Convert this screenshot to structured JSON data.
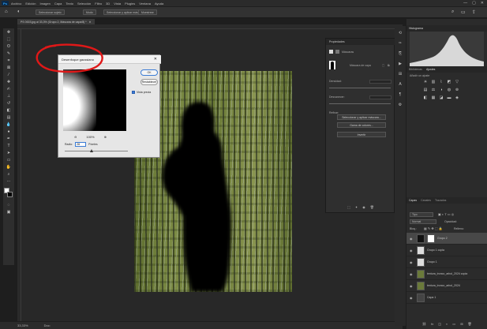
{
  "app": {
    "logo": "Ps",
    "menu": [
      "Archivo",
      "Edición",
      "Imagen",
      "Capa",
      "Texto",
      "Selección",
      "Filtro",
      "3D",
      "Vista",
      "Plugins",
      "Ventana",
      "Ayuda"
    ],
    "window_controls": [
      "—",
      "▢",
      "✕"
    ]
  },
  "options_bar": {
    "select_subject": "Seleccionar sujeto",
    "mode_icon_label": "Modo",
    "select_mask": "Seleccionar y aplicar máscara...",
    "option_extra": "Muestrear"
  },
  "document_tab": {
    "title": "PS 0003.jpg al 33,3% (Grupo 2, Máscara de capa/8) *",
    "close": "✕"
  },
  "status_bar": {
    "zoom": "33,33%",
    "info": "Doc:"
  },
  "dialog": {
    "title": "Desenfoque gaussiano",
    "close": "✕",
    "ok": "OK",
    "reset": "Restablecer",
    "preview_label": "Vista previa",
    "zoom_out": "⊖",
    "zoom_level": "100%",
    "zoom_in": "⊕",
    "radius_label": "Radio:",
    "radius_value": "28",
    "radius_unit": "Píxeles"
  },
  "properties": {
    "header": "Propiedades",
    "mask_label": "Máscaras",
    "layer_mask": "Máscara de capa",
    "density_label": "Densidad:",
    "feather_label": "Desvanecer:",
    "refine_label": "Refinar:",
    "select_and_mask": "Seleccionar y aplicar máscara...",
    "color_range": "Gama de colores...",
    "invert": "Invertir"
  },
  "right_panels": {
    "histogram_tab": "Histograma",
    "library_tab": "Bibliotecas",
    "adjustments_tab": "Ajustes",
    "add_adjustment": "Añadir un ajuste",
    "layers_tab": "Capas",
    "channels_tab": "Canales",
    "paths_tab": "Trazados",
    "kind_filter": "Tipo",
    "blend_mode": "Normal",
    "opacity_label": "Opacidad:",
    "lock_label": "Bloq.:",
    "fill_label": "Relleno:",
    "layers": [
      {
        "name": "Grupo 2",
        "selected": true
      },
      {
        "name": "Grupo 1 copia"
      },
      {
        "name": "Grupo 1"
      },
      {
        "name": "textura_tronco_arbol_2024 copia"
      },
      {
        "name": "textura_tronco_arbol_2024"
      },
      {
        "name": "Capa 1"
      }
    ]
  },
  "colors": {
    "accent": "#31a8ff",
    "annotation": "#e01818"
  }
}
